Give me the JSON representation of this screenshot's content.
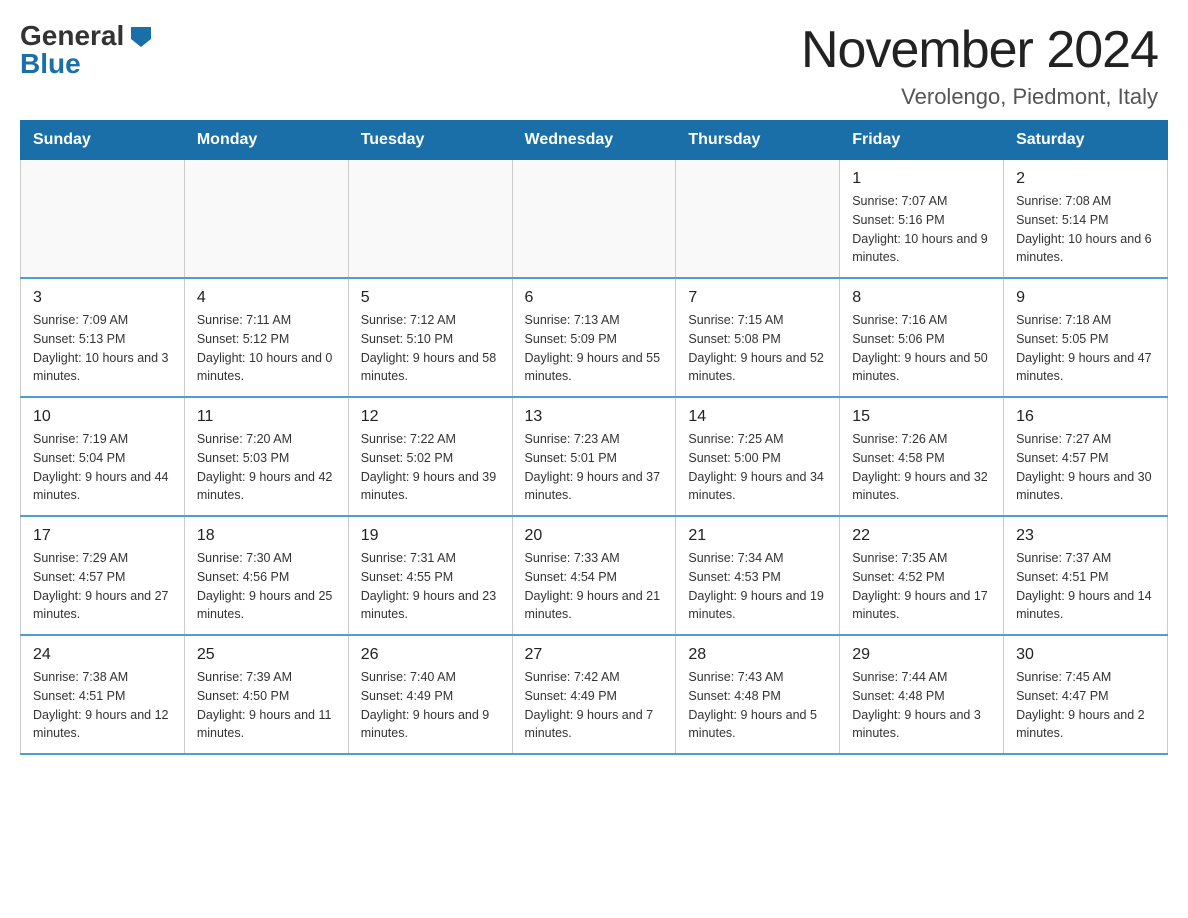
{
  "header": {
    "logo_general": "General",
    "logo_blue": "Blue",
    "month": "November 2024",
    "location": "Verolengo, Piedmont, Italy"
  },
  "weekdays": [
    "Sunday",
    "Monday",
    "Tuesday",
    "Wednesday",
    "Thursday",
    "Friday",
    "Saturday"
  ],
  "weeks": [
    {
      "days": [
        {
          "number": "",
          "info": ""
        },
        {
          "number": "",
          "info": ""
        },
        {
          "number": "",
          "info": ""
        },
        {
          "number": "",
          "info": ""
        },
        {
          "number": "",
          "info": ""
        },
        {
          "number": "1",
          "info": "Sunrise: 7:07 AM\nSunset: 5:16 PM\nDaylight: 10 hours and 9 minutes."
        },
        {
          "number": "2",
          "info": "Sunrise: 7:08 AM\nSunset: 5:14 PM\nDaylight: 10 hours and 6 minutes."
        }
      ]
    },
    {
      "days": [
        {
          "number": "3",
          "info": "Sunrise: 7:09 AM\nSunset: 5:13 PM\nDaylight: 10 hours and 3 minutes."
        },
        {
          "number": "4",
          "info": "Sunrise: 7:11 AM\nSunset: 5:12 PM\nDaylight: 10 hours and 0 minutes."
        },
        {
          "number": "5",
          "info": "Sunrise: 7:12 AM\nSunset: 5:10 PM\nDaylight: 9 hours and 58 minutes."
        },
        {
          "number": "6",
          "info": "Sunrise: 7:13 AM\nSunset: 5:09 PM\nDaylight: 9 hours and 55 minutes."
        },
        {
          "number": "7",
          "info": "Sunrise: 7:15 AM\nSunset: 5:08 PM\nDaylight: 9 hours and 52 minutes."
        },
        {
          "number": "8",
          "info": "Sunrise: 7:16 AM\nSunset: 5:06 PM\nDaylight: 9 hours and 50 minutes."
        },
        {
          "number": "9",
          "info": "Sunrise: 7:18 AM\nSunset: 5:05 PM\nDaylight: 9 hours and 47 minutes."
        }
      ]
    },
    {
      "days": [
        {
          "number": "10",
          "info": "Sunrise: 7:19 AM\nSunset: 5:04 PM\nDaylight: 9 hours and 44 minutes."
        },
        {
          "number": "11",
          "info": "Sunrise: 7:20 AM\nSunset: 5:03 PM\nDaylight: 9 hours and 42 minutes."
        },
        {
          "number": "12",
          "info": "Sunrise: 7:22 AM\nSunset: 5:02 PM\nDaylight: 9 hours and 39 minutes."
        },
        {
          "number": "13",
          "info": "Sunrise: 7:23 AM\nSunset: 5:01 PM\nDaylight: 9 hours and 37 minutes."
        },
        {
          "number": "14",
          "info": "Sunrise: 7:25 AM\nSunset: 5:00 PM\nDaylight: 9 hours and 34 minutes."
        },
        {
          "number": "15",
          "info": "Sunrise: 7:26 AM\nSunset: 4:58 PM\nDaylight: 9 hours and 32 minutes."
        },
        {
          "number": "16",
          "info": "Sunrise: 7:27 AM\nSunset: 4:57 PM\nDaylight: 9 hours and 30 minutes."
        }
      ]
    },
    {
      "days": [
        {
          "number": "17",
          "info": "Sunrise: 7:29 AM\nSunset: 4:57 PM\nDaylight: 9 hours and 27 minutes."
        },
        {
          "number": "18",
          "info": "Sunrise: 7:30 AM\nSunset: 4:56 PM\nDaylight: 9 hours and 25 minutes."
        },
        {
          "number": "19",
          "info": "Sunrise: 7:31 AM\nSunset: 4:55 PM\nDaylight: 9 hours and 23 minutes."
        },
        {
          "number": "20",
          "info": "Sunrise: 7:33 AM\nSunset: 4:54 PM\nDaylight: 9 hours and 21 minutes."
        },
        {
          "number": "21",
          "info": "Sunrise: 7:34 AM\nSunset: 4:53 PM\nDaylight: 9 hours and 19 minutes."
        },
        {
          "number": "22",
          "info": "Sunrise: 7:35 AM\nSunset: 4:52 PM\nDaylight: 9 hours and 17 minutes."
        },
        {
          "number": "23",
          "info": "Sunrise: 7:37 AM\nSunset: 4:51 PM\nDaylight: 9 hours and 14 minutes."
        }
      ]
    },
    {
      "days": [
        {
          "number": "24",
          "info": "Sunrise: 7:38 AM\nSunset: 4:51 PM\nDaylight: 9 hours and 12 minutes."
        },
        {
          "number": "25",
          "info": "Sunrise: 7:39 AM\nSunset: 4:50 PM\nDaylight: 9 hours and 11 minutes."
        },
        {
          "number": "26",
          "info": "Sunrise: 7:40 AM\nSunset: 4:49 PM\nDaylight: 9 hours and 9 minutes."
        },
        {
          "number": "27",
          "info": "Sunrise: 7:42 AM\nSunset: 4:49 PM\nDaylight: 9 hours and 7 minutes."
        },
        {
          "number": "28",
          "info": "Sunrise: 7:43 AM\nSunset: 4:48 PM\nDaylight: 9 hours and 5 minutes."
        },
        {
          "number": "29",
          "info": "Sunrise: 7:44 AM\nSunset: 4:48 PM\nDaylight: 9 hours and 3 minutes."
        },
        {
          "number": "30",
          "info": "Sunrise: 7:45 AM\nSunset: 4:47 PM\nDaylight: 9 hours and 2 minutes."
        }
      ]
    }
  ]
}
